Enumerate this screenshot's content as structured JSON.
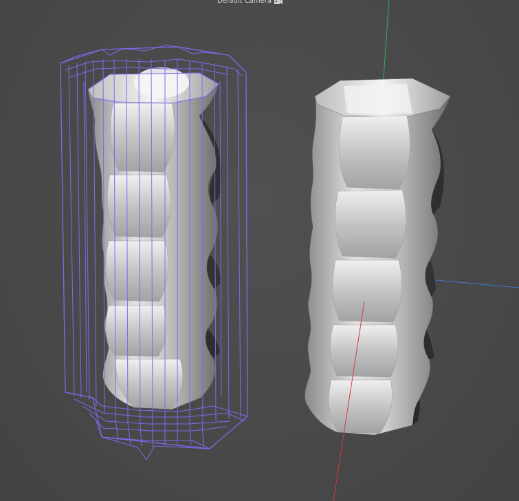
{
  "viewport": {
    "camera_label": "Default Camera",
    "camera_icon": "camera-icon"
  },
  "colors": {
    "background": "#4b4b4b",
    "wireframe": "#7b6cf0",
    "axis_x": "#d23a3a",
    "axis_y": "#33b05a",
    "axis_z": "#3a7bd2",
    "mesh_light": "#e6e6e6",
    "mesh_dark": "#7a7a7a"
  },
  "objects": [
    {
      "name": "deformer-cage-object",
      "selected": true
    },
    {
      "name": "vase-object",
      "selected": false
    }
  ]
}
